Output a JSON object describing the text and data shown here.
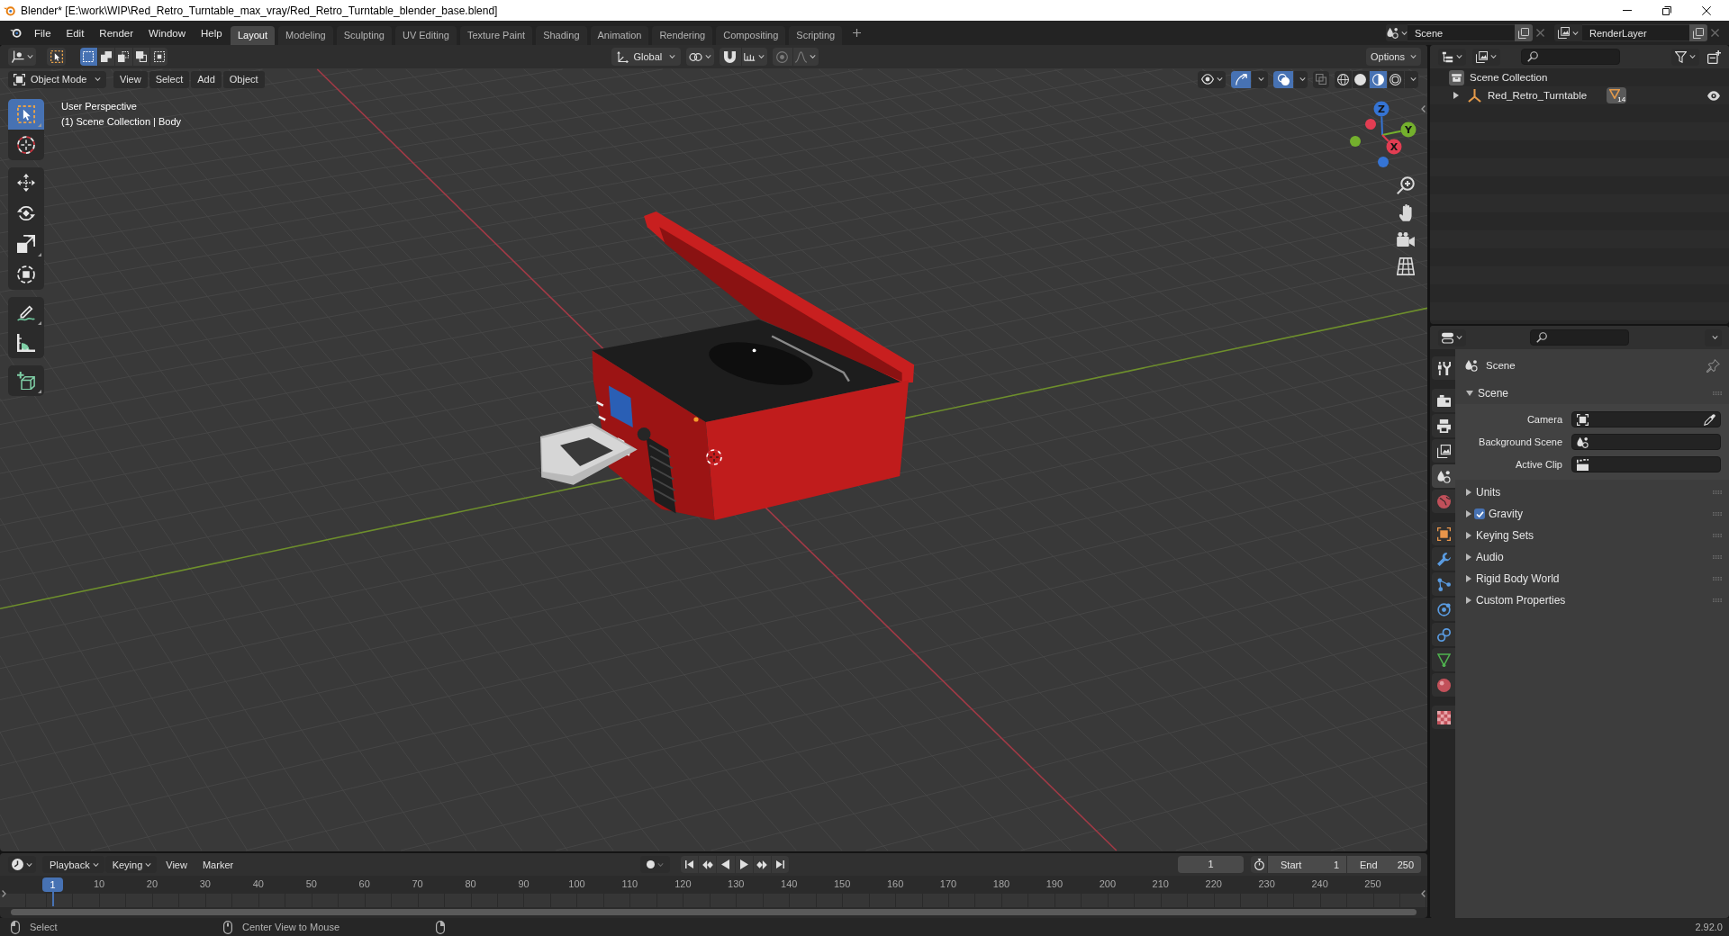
{
  "window": {
    "title": "Blender* [E:\\work\\WIP\\Red_Retro_Turntable_max_vray/Red_Retro_Turntable_blender_base.blend]"
  },
  "menu": [
    "File",
    "Edit",
    "Render",
    "Window",
    "Help"
  ],
  "workspaces": [
    {
      "label": "Layout",
      "selected": true
    },
    {
      "label": "Modeling",
      "selected": false
    },
    {
      "label": "Sculpting",
      "selected": false
    },
    {
      "label": "UV Editing",
      "selected": false
    },
    {
      "label": "Texture Paint",
      "selected": false
    },
    {
      "label": "Shading",
      "selected": false
    },
    {
      "label": "Animation",
      "selected": false
    },
    {
      "label": "Rendering",
      "selected": false
    },
    {
      "label": "Compositing",
      "selected": false
    },
    {
      "label": "Scripting",
      "selected": false
    }
  ],
  "scene": {
    "name": "Scene",
    "view_layer": "RenderLayer"
  },
  "viewport": {
    "select_modes": [
      {
        "kind": "set",
        "selected": true
      },
      {
        "kind": "extend",
        "selected": false
      },
      {
        "kind": "subtract",
        "selected": false
      },
      {
        "kind": "invert",
        "selected": false
      },
      {
        "kind": "intersect",
        "selected": false
      }
    ],
    "orientation": "Global",
    "snap": false,
    "proportional_editing": false,
    "options": "Options",
    "mode": "Object Mode",
    "menus": [
      "View",
      "Select",
      "Add",
      "Object"
    ],
    "gizmos": true,
    "overlays": true,
    "xray": false,
    "shading": [
      {
        "kind": "wireframe",
        "selected": false
      },
      {
        "kind": "solid",
        "selected": false
      },
      {
        "kind": "material",
        "selected": true
      },
      {
        "kind": "rendered",
        "selected": false
      }
    ],
    "info": [
      "User Perspective",
      "(1) Scene Collection | Body"
    ],
    "tool_groups": [
      {
        "tools": [
          {
            "kind": "select_box",
            "selected": true
          },
          {
            "kind": "cursor",
            "selected": false
          }
        ]
      },
      {
        "tools": [
          {
            "kind": "move",
            "selected": false
          },
          {
            "kind": "rotate",
            "selected": false
          },
          {
            "kind": "scale",
            "selected": false
          },
          {
            "kind": "transform",
            "selected": false
          }
        ]
      },
      {
        "tools": [
          {
            "kind": "annotate",
            "selected": false
          },
          {
            "kind": "measure",
            "selected": false
          }
        ]
      },
      {
        "tools": [
          {
            "kind": "add_cube",
            "selected": false
          }
        ]
      }
    ],
    "axes": [
      {
        "kind": "z",
        "label": "Z",
        "color": "#3574d4"
      },
      {
        "kind": "y",
        "label": "Y",
        "color": "#74b02d"
      },
      {
        "kind": "x",
        "label": "X",
        "color": "#e23d52"
      }
    ]
  },
  "outliner": {
    "tree": [
      {
        "label": "Scene Collection",
        "children": [
          {
            "label": "Red_Retro_Turntable",
            "expanded": false,
            "child_count": "14",
            "visible": true
          }
        ]
      }
    ]
  },
  "properties": {
    "tab_groups": [
      {
        "tabs": [
          {
            "kind": "tool",
            "selected": false
          }
        ]
      },
      {
        "tabs": [
          {
            "kind": "render",
            "selected": false
          },
          {
            "kind": "output",
            "selected": false
          },
          {
            "kind": "view_layer",
            "selected": false
          },
          {
            "kind": "scene",
            "selected": true
          },
          {
            "kind": "world",
            "selected": false
          }
        ]
      },
      {
        "tabs": [
          {
            "kind": "object",
            "selected": false
          },
          {
            "kind": "modifiers",
            "selected": false
          },
          {
            "kind": "particles",
            "selected": false
          },
          {
            "kind": "physics",
            "selected": false
          },
          {
            "kind": "constraints",
            "selected": false
          },
          {
            "kind": "data",
            "selected": false
          },
          {
            "kind": "material",
            "selected": false
          }
        ]
      },
      {
        "tabs": [
          {
            "kind": "texture",
            "selected": false
          }
        ]
      }
    ],
    "context": "Scene",
    "panels": [
      {
        "kind": "plain",
        "label": "Scene",
        "expanded": true,
        "fields": [
          {
            "kind": "camera",
            "label": "Camera"
          },
          {
            "kind": "scene",
            "label": "Background Scene"
          },
          {
            "kind": "clip",
            "label": "Active Clip"
          }
        ]
      },
      {
        "kind": "plain",
        "label": "Units",
        "expanded": false
      },
      {
        "kind": "checkbox",
        "label": "Gravity",
        "expanded": false,
        "checked": true
      },
      {
        "kind": "plain",
        "label": "Keying Sets",
        "expanded": false
      },
      {
        "kind": "plain",
        "label": "Audio",
        "expanded": false
      },
      {
        "kind": "plain",
        "label": "Rigid Body World",
        "expanded": false
      },
      {
        "kind": "plain",
        "label": "Custom Properties",
        "expanded": false
      }
    ]
  },
  "timeline": {
    "menus": [
      {
        "kind": "dropdown",
        "label": "Playback"
      },
      {
        "kind": "dropdown",
        "label": "Keying"
      },
      {
        "kind": "plain",
        "label": "View"
      },
      {
        "kind": "plain",
        "label": "Marker"
      }
    ],
    "auto_keying": false,
    "current_frame": "1",
    "preview_range": false,
    "start_label": "Start",
    "start": "1",
    "end_label": "End",
    "end": "250",
    "playhead": "1",
    "ruler": [
      "10",
      "20",
      "30",
      "40",
      "50",
      "60",
      "70",
      "80",
      "90",
      "100",
      "110",
      "120",
      "130",
      "140",
      "150",
      "160",
      "170",
      "180",
      "190",
      "200",
      "210",
      "220",
      "230",
      "240",
      "250"
    ]
  },
  "status_bar": {
    "hints": [
      {
        "kind": "left",
        "label": "Select"
      },
      {
        "kind": "middle",
        "label": "Center View to Mouse"
      },
      {
        "kind": "right"
      }
    ],
    "version": "2.92.0"
  }
}
